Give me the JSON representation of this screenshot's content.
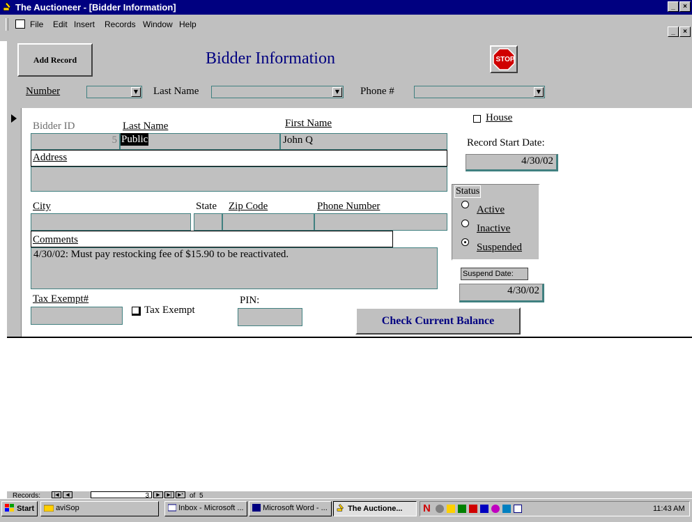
{
  "window": {
    "title": "The Auctioneer - [Bidder Information]",
    "controls": [
      "_",
      "×"
    ]
  },
  "menu": {
    "items": [
      "File",
      "Edit",
      "Insert",
      "Records",
      "Window",
      "Help"
    ]
  },
  "header": {
    "add_record_label": "Add Record",
    "form_title": "Bidder Information",
    "stop_label": "STOP",
    "number_label": "Number",
    "last_name_label": "Last Name",
    "phone_label": "Phone #"
  },
  "record": {
    "bidder_id_label": "Bidder ID",
    "bidder_id_value": "5",
    "last_name_label": "Last Name",
    "last_name_value": "Public",
    "first_name_label": "First Name",
    "first_name_value": "John Q",
    "house_label": "House",
    "house_checked": false,
    "record_start_label": "Record Start Date:",
    "record_start_value": "4/30/02",
    "address_label": "Address",
    "address_value": "",
    "city_label": "City",
    "state_label": "State",
    "zip_label": "Zip Code",
    "phone_number_label": "Phone Number",
    "comments_label": "Comments",
    "comments_value": "4/30/02: Must pay restocking fee of $15.90 to be reactivated.",
    "tax_exempt_num_label": "Tax Exempt#",
    "tax_exempt_label": "Tax Exempt",
    "tax_exempt_checked": false,
    "pin_label": "PIN:",
    "check_balance_label": "Check Current Balance"
  },
  "status": {
    "group_label": "Status",
    "options": [
      "Active",
      "Inactive",
      "Suspended"
    ],
    "selected": "Suspended",
    "suspend_date_label": "Suspend Date:",
    "suspend_date_value": "4/30/02"
  },
  "navigation": {
    "records_label": "Records:",
    "current": "3",
    "of_label": "of",
    "total": "5"
  },
  "taskbar": {
    "start_label": "Start",
    "tasks": [
      "aviSop",
      "Inbox - Microsoft ...",
      "Microsoft Word - ...",
      "The Auctione..."
    ],
    "clock": "11:43 AM"
  },
  "colors": {
    "titlebar": "#000080",
    "form_gray": "#c0c0c0",
    "field_border": "#408080",
    "stop_red": "#d00000"
  }
}
